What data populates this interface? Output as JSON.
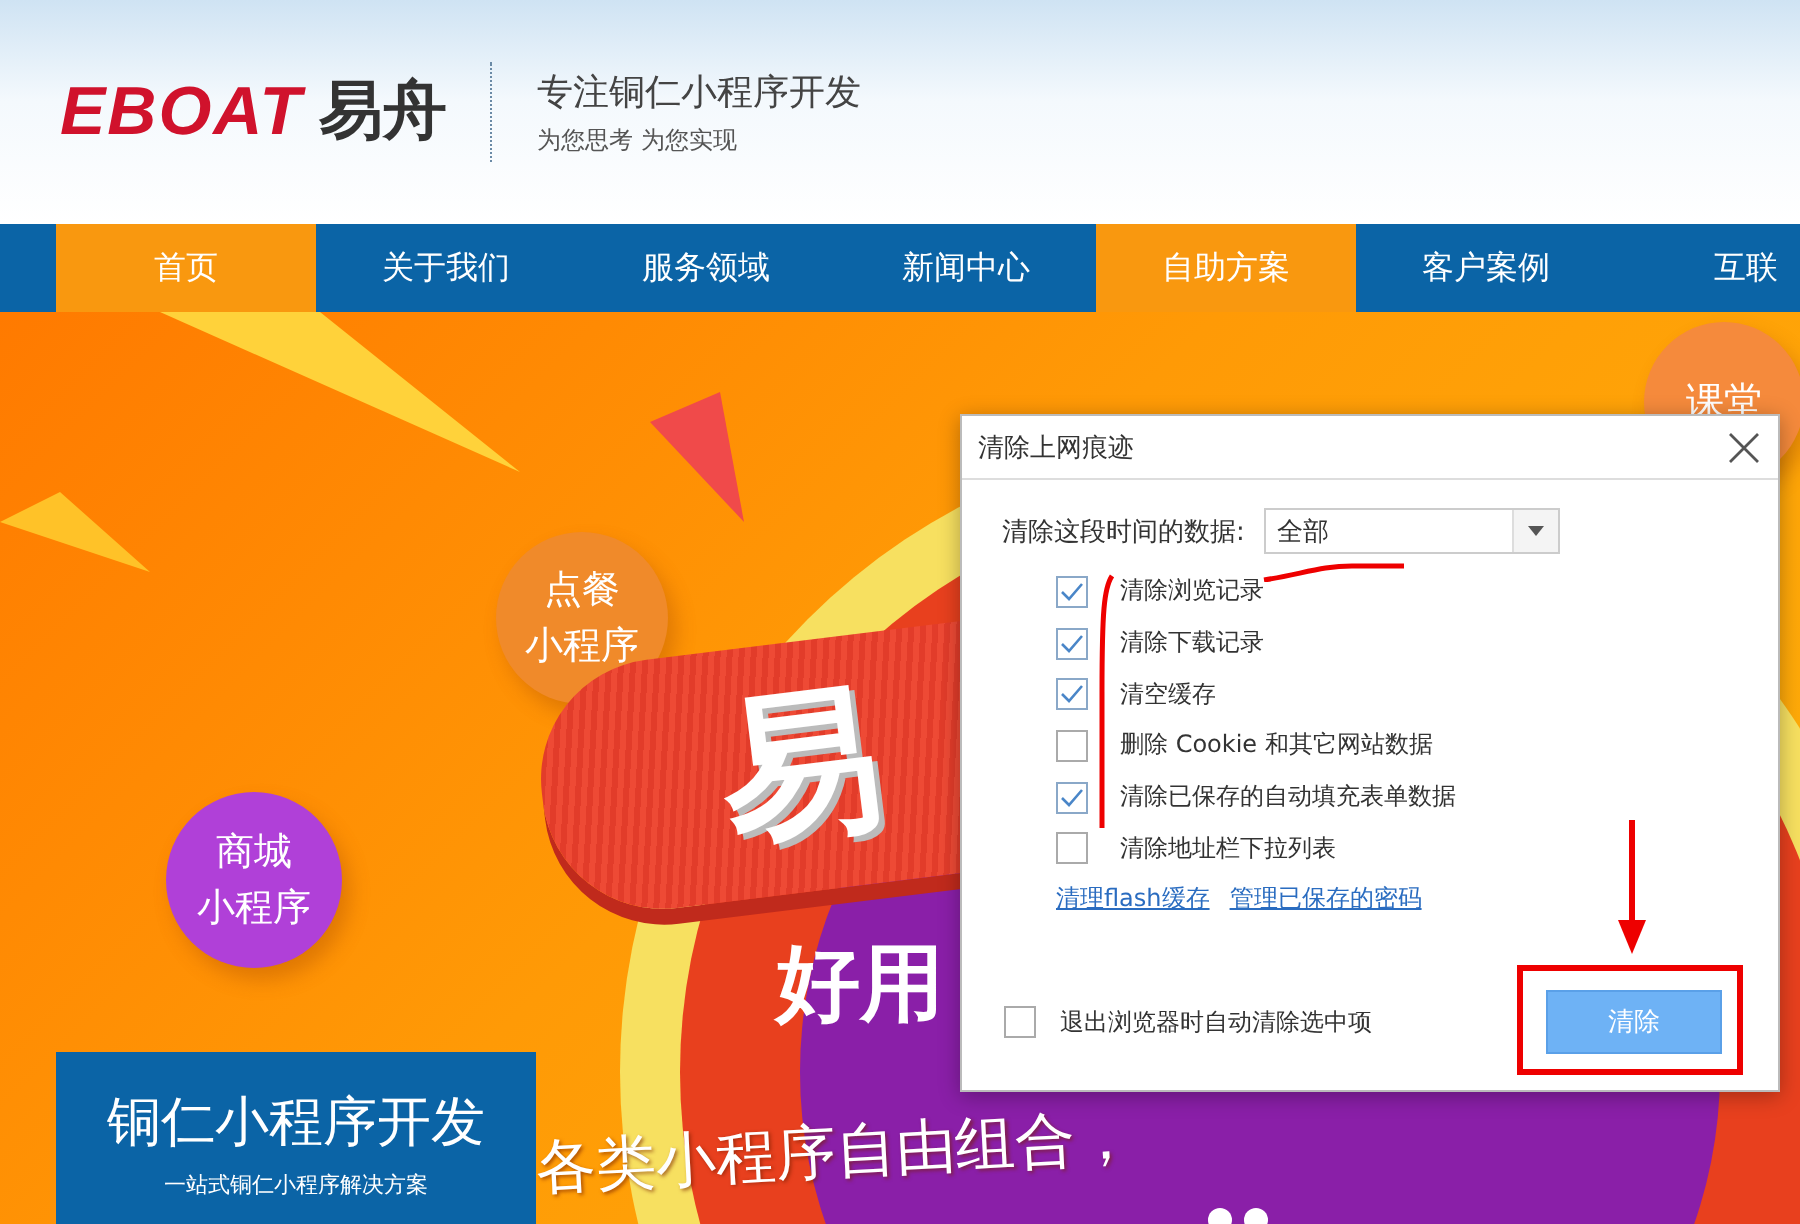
{
  "header": {
    "logo_latin": "EBOAT",
    "logo_chinese": "易舟",
    "slogan": "专注铜仁小程序开发",
    "subslogan": "为您思考 为您实现"
  },
  "nav": [
    {
      "label": "首页",
      "selected": true
    },
    {
      "label": "关于我们",
      "selected": false
    },
    {
      "label": "服务领域",
      "selected": false
    },
    {
      "label": "新闻中心",
      "selected": false
    },
    {
      "label": "自助方案",
      "selected": true
    },
    {
      "label": "客户案例",
      "selected": false
    },
    {
      "label": "互联",
      "selected": false
    }
  ],
  "banner": {
    "bubbles": [
      {
        "lines": [
          "课堂"
        ],
        "color": "#f58a3c"
      },
      {
        "lines": [
          "点餐",
          "小程序"
        ],
        "color": "#f08a2a"
      },
      {
        "lines": [
          "商城",
          "小程序"
        ],
        "color": "#b040d8"
      }
    ],
    "headline": "易",
    "tagline": "好用",
    "subline": "各类小程序自由组合，",
    "caption_title": "铜仁小程序开发",
    "caption_subtitle": "一站式铜仁小程序解决方案"
  },
  "dialog": {
    "title": "清除上网痕迹",
    "range_label": "清除这段时间的数据:",
    "range_value": "全部",
    "options": [
      {
        "label": "清除浏览记录",
        "checked": true
      },
      {
        "label": "清除下载记录",
        "checked": true
      },
      {
        "label": "清空缓存",
        "checked": true
      },
      {
        "label": "删除 Cookie 和其它网站数据",
        "checked": false
      },
      {
        "label": "清除已保存的自动填充表单数据",
        "checked": true
      },
      {
        "label": "清除地址栏下拉列表",
        "checked": false
      }
    ],
    "links": [
      "清理flash缓存",
      "管理已保存的密码"
    ],
    "exit_option": {
      "label": "退出浏览器时自动清除选中项",
      "checked": false
    },
    "button": "清除"
  }
}
